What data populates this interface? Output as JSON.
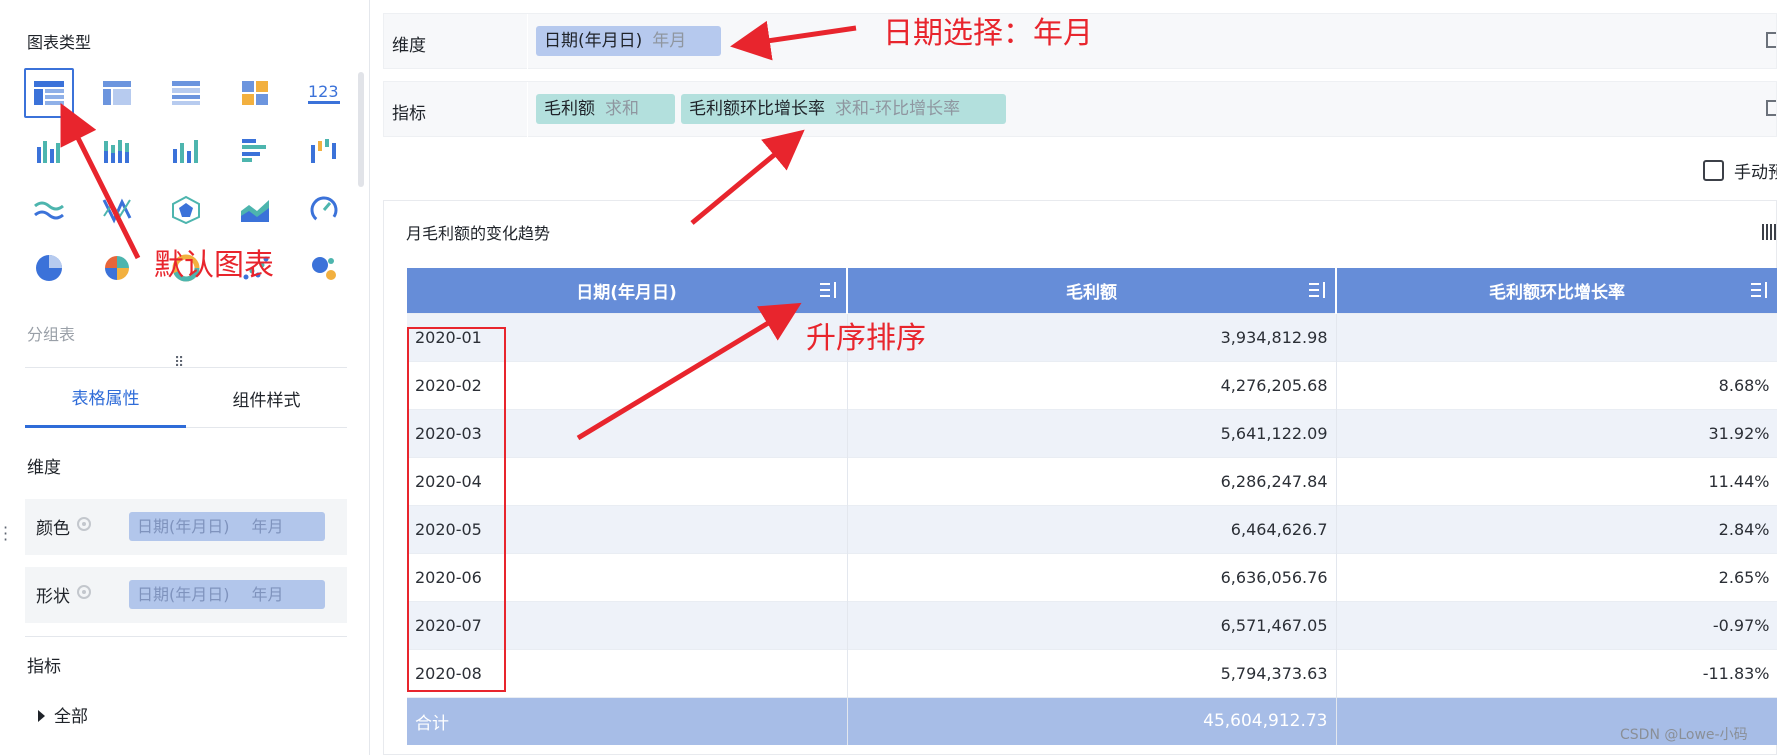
{
  "left_panel": {
    "chart_type_title": "图表类型",
    "group_title": "分组表",
    "tabs": [
      {
        "label": "表格属性",
        "active": true
      },
      {
        "label": "组件样式",
        "active": false
      }
    ],
    "dimension_label": "维度",
    "color_row": {
      "label": "颜色",
      "field": "日期(年月日)",
      "granularity": "年月"
    },
    "shape_row": {
      "label": "形状",
      "field": "日期(年月日)",
      "granularity": "年月"
    },
    "metric_label": "指标",
    "all_node": "全部",
    "chart_icons": [
      "table-chart-icon",
      "cross-table-icon",
      "detail-table-icon",
      "kpi-grid-icon",
      "number-icon",
      "grouped-column-icon",
      "stacked-column-icon",
      "column-chart-icon",
      "bar-chart-icon",
      "waterfall-icon",
      "line-chart-icon",
      "radar-line-icon",
      "radar-chart-icon",
      "area-chart-icon",
      "gauge-icon",
      "pie-chart-icon",
      "rose-chart-icon",
      "ring-chart-icon",
      "scatter-icon",
      "bubble-icon"
    ]
  },
  "config": {
    "dimension_label": "维度",
    "dimension_pill": {
      "field": "日期(年月日)",
      "granularity": "年月"
    },
    "metric_label": "指标",
    "metric_pills": [
      {
        "field": "毛利额",
        "aggregation": "求和"
      },
      {
        "field": "毛利额环比增长率",
        "aggregation": "求和-环比增长率"
      }
    ],
    "manual_label": "手动预"
  },
  "card": {
    "title": "月毛利额的变化趋势",
    "columns": [
      "日期(年月日)",
      "毛利额",
      "毛利额环比增长率"
    ],
    "rows": [
      {
        "date": "2020-01",
        "profit": "3,934,812.98",
        "growth": ""
      },
      {
        "date": "2020-02",
        "profit": "4,276,205.68",
        "growth": "8.68%"
      },
      {
        "date": "2020-03",
        "profit": "5,641,122.09",
        "growth": "31.92%"
      },
      {
        "date": "2020-04",
        "profit": "6,286,247.84",
        "growth": "11.44%"
      },
      {
        "date": "2020-05",
        "profit": "6,464,626.7",
        "growth": "2.84%"
      },
      {
        "date": "2020-06",
        "profit": "6,636,056.76",
        "growth": "2.65%"
      },
      {
        "date": "2020-07",
        "profit": "6,571,467.05",
        "growth": "-0.97%"
      },
      {
        "date": "2020-08",
        "profit": "5,794,373.63",
        "growth": "-11.83%"
      }
    ],
    "total": {
      "label": "合计",
      "profit": "45,604,912.73",
      "growth": ""
    }
  },
  "annotations": {
    "date_select": "日期选择：年月",
    "default_chart": "默认图表",
    "ascending_sort": "升序排序",
    "color": "#e8252d"
  },
  "watermark": "CSDN @Lowe-小码",
  "colors": {
    "header_blue": "#668dd8",
    "total_row": "#a7bde7",
    "accent": "#2f6cd8",
    "pill_blue": "#b6c9ee",
    "pill_teal": "#b3e0dd"
  }
}
